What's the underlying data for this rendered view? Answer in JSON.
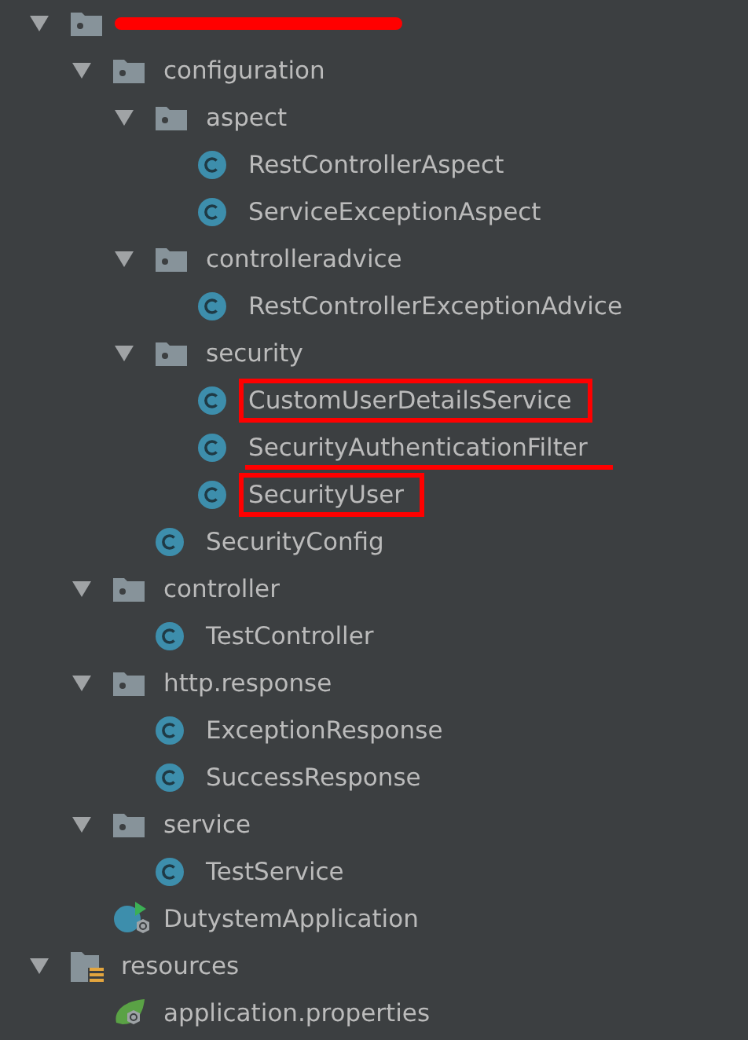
{
  "tree": [
    {
      "kind": "package",
      "redacted": true,
      "expanded": true,
      "children": [
        {
          "kind": "package",
          "name": "configuration",
          "expanded": true,
          "children": [
            {
              "kind": "package",
              "name": "aspect",
              "expanded": true,
              "children": [
                {
                  "kind": "class",
                  "name": "RestControllerAspect"
                },
                {
                  "kind": "class",
                  "name": "ServiceExceptionAspect"
                }
              ]
            },
            {
              "kind": "package",
              "name": "controlleradvice",
              "expanded": true,
              "children": [
                {
                  "kind": "class",
                  "name": "RestControllerExceptionAdvice"
                }
              ]
            },
            {
              "kind": "package",
              "name": "security",
              "expanded": true,
              "children": [
                {
                  "kind": "class",
                  "name": "CustomUserDetailsService",
                  "highlighted": true
                },
                {
                  "kind": "class",
                  "name": "SecurityAuthenticationFilter",
                  "struck": true
                },
                {
                  "kind": "class",
                  "name": "SecurityUser",
                  "highlighted": true
                }
              ]
            },
            {
              "kind": "class",
              "name": "SecurityConfig"
            }
          ]
        },
        {
          "kind": "package",
          "name": "controller",
          "expanded": true,
          "children": [
            {
              "kind": "class",
              "name": "TestController"
            }
          ]
        },
        {
          "kind": "package",
          "name": "http.response",
          "expanded": true,
          "children": [
            {
              "kind": "class",
              "name": "ExceptionResponse"
            },
            {
              "kind": "class",
              "name": "SuccessResponse"
            }
          ]
        },
        {
          "kind": "package",
          "name": "service",
          "expanded": true,
          "children": [
            {
              "kind": "class",
              "name": "TestService"
            }
          ]
        },
        {
          "kind": "spring-app",
          "name": "DutystemApplication"
        }
      ]
    },
    {
      "kind": "resources",
      "name": "resources",
      "expanded": true,
      "children": [
        {
          "kind": "properties",
          "name": "application.properties"
        }
      ]
    }
  ]
}
